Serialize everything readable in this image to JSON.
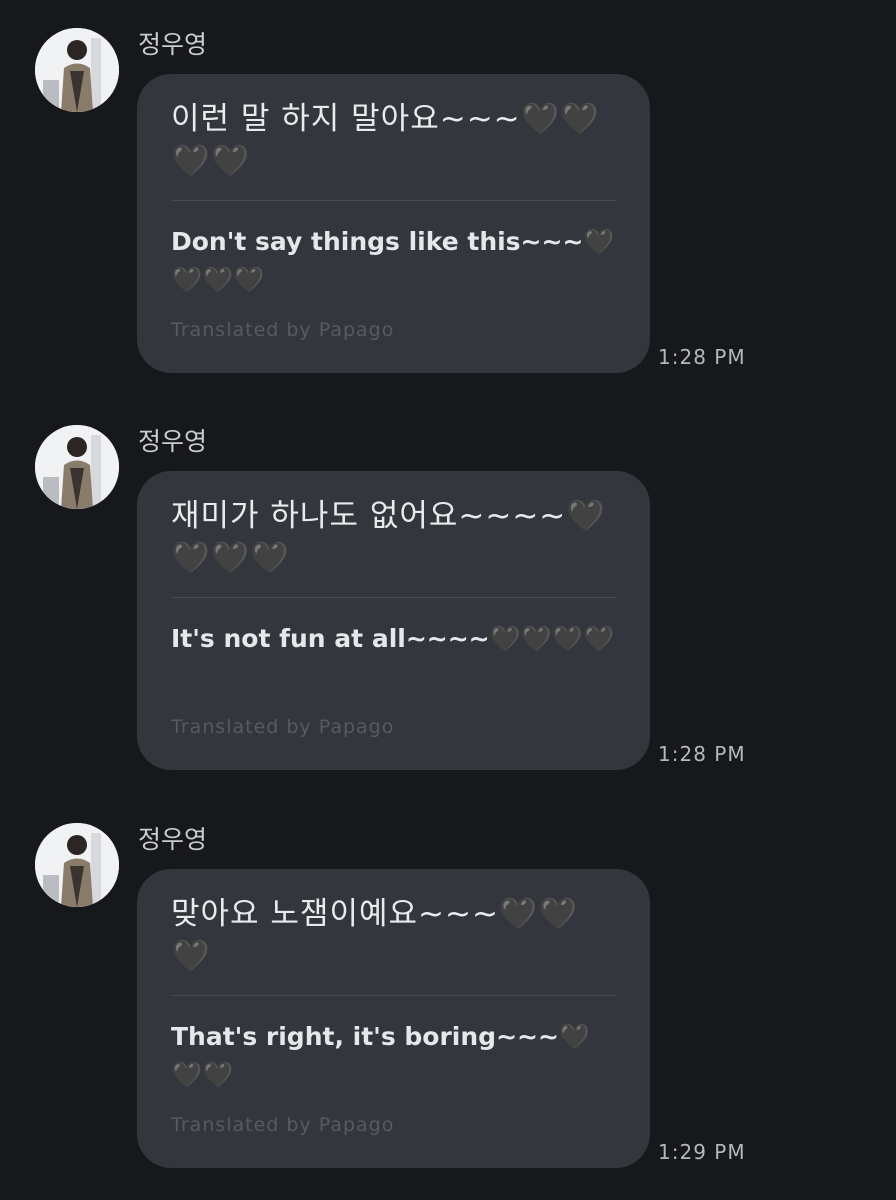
{
  "messages": [
    {
      "sender": "정우영",
      "original": "이런 말 하지 말아요~~~🖤🖤🖤🖤",
      "translated": "Don't say things like this~~~🖤🖤🖤🖤",
      "credit": "Translated by Papago",
      "time": "1:28 PM",
      "avatar_icon": "profile-photo"
    },
    {
      "sender": "정우영",
      "original": "재미가 하나도 없어요~~~~🖤🖤🖤🖤",
      "translated": "It's not fun at all~~~~🖤🖤🖤🖤",
      "credit": "Translated by Papago",
      "time": "1:28 PM",
      "avatar_icon": "profile-photo"
    },
    {
      "sender": "정우영",
      "original": "맞아요 노잼이예요~~~🖤🖤🖤",
      "translated": "That's right, it's boring~~~🖤🖤🖤",
      "credit": "Translated by Papago",
      "time": "1:29 PM",
      "avatar_icon": "profile-photo"
    }
  ],
  "colors": {
    "background": "#17181c",
    "bubble": "#34363d",
    "text": "#e9eaec",
    "muted": "#575a61"
  }
}
